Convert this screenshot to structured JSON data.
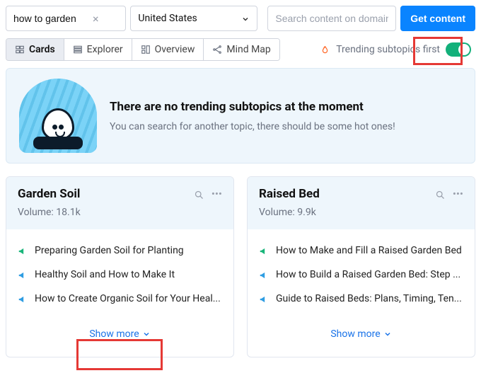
{
  "topbar": {
    "search_value": "how to garden",
    "country": "United States",
    "domain_placeholder": "Search content on domain",
    "get_content_label": "Get content"
  },
  "tabs": {
    "items": [
      {
        "label": "Cards",
        "icon": "cards-icon"
      },
      {
        "label": "Explorer",
        "icon": "explorer-icon"
      },
      {
        "label": "Overview",
        "icon": "overview-icon"
      },
      {
        "label": "Mind Map",
        "icon": "mindmap-icon"
      }
    ],
    "active_index": 0,
    "trending_label": "Trending subtopics first",
    "trending_on": true
  },
  "empty_state": {
    "title": "There are no trending subtopics at the moment",
    "subtitle": "You can search for another topic, there should be some hot ones!"
  },
  "cards": [
    {
      "title": "Garden Soil",
      "volume_label": "Volume:",
      "volume_value": "18.1k",
      "items": [
        {
          "color": "green",
          "text": "Preparing Garden Soil for Planting"
        },
        {
          "color": "blue",
          "text": "Healthy Soil and How to Make It"
        },
        {
          "color": "blue",
          "text": "How to Create Organic Soil for Your Heal..."
        }
      ],
      "show_more": "Show more"
    },
    {
      "title": "Raised Bed",
      "volume_label": "Volume:",
      "volume_value": "9.9k",
      "items": [
        {
          "color": "green",
          "text": "How to Make and Fill a Raised Garden Bed"
        },
        {
          "color": "blue",
          "text": "How to Build a Raised Garden Bed: Step ..."
        },
        {
          "color": "blue",
          "text": "Guide to Raised Beds: Plans, Timing, Ten..."
        }
      ],
      "show_more": "Show more"
    }
  ]
}
